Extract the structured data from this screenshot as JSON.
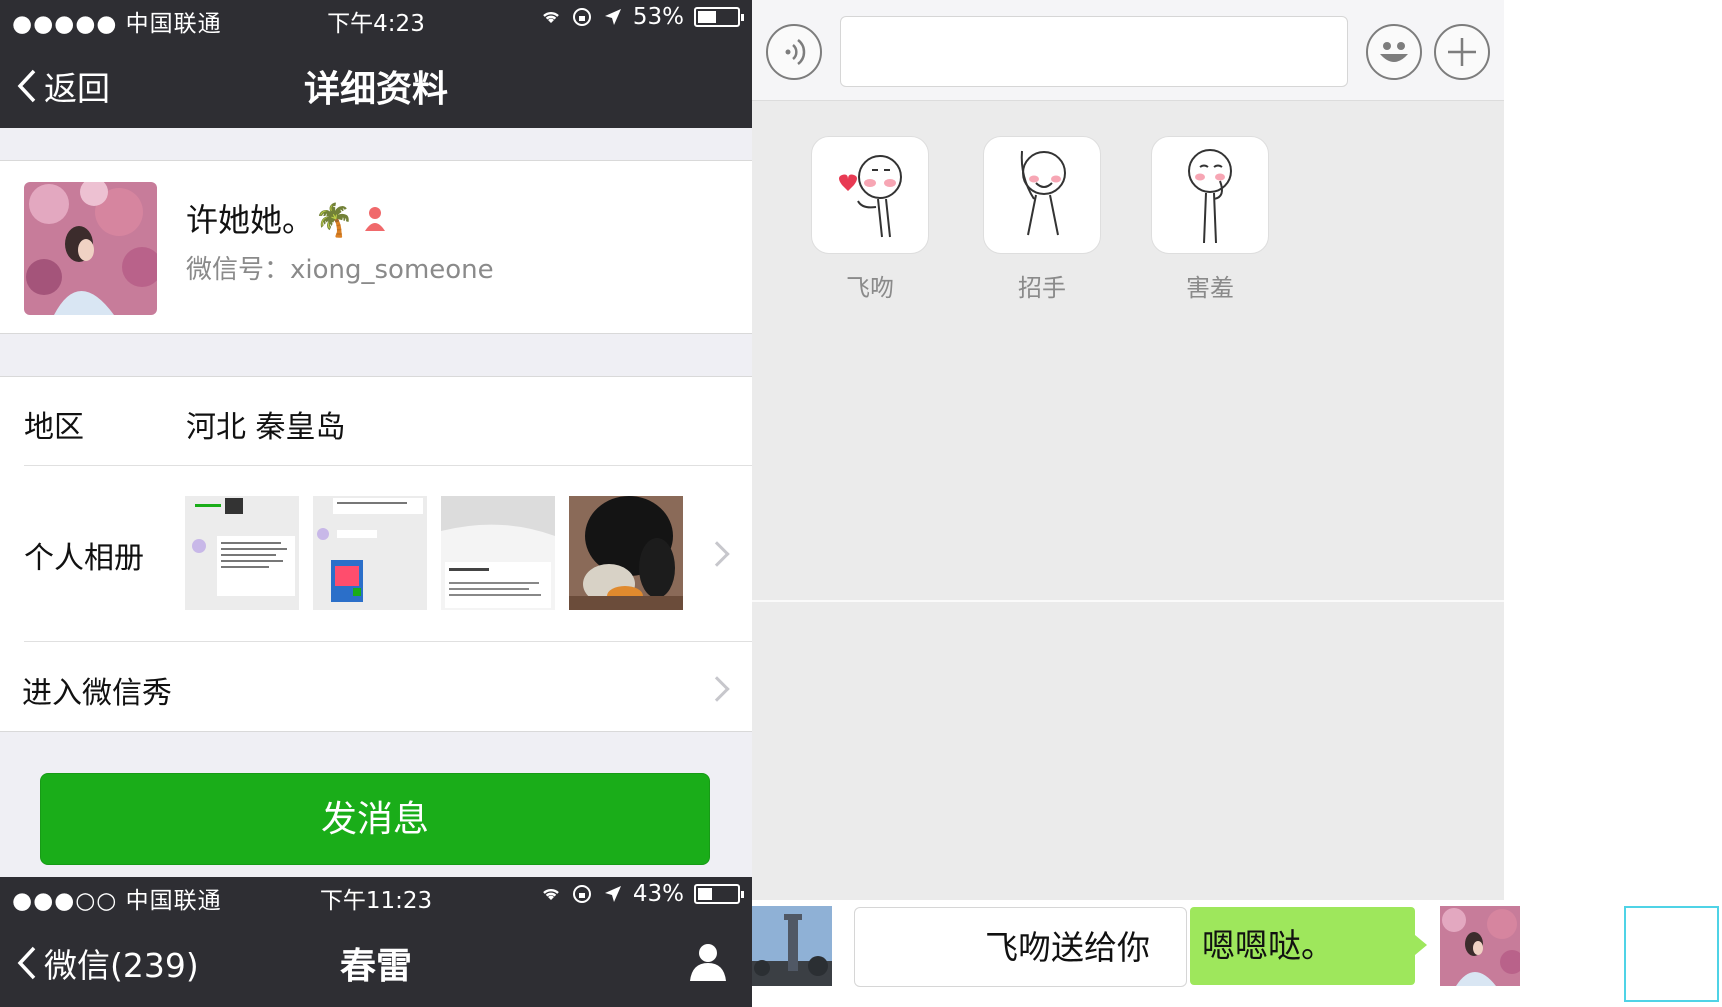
{
  "screen1": {
    "status": {
      "carrier": "●●●●● 中国联通",
      "time": "下午4:23",
      "battery": "53%",
      "battery_level": 0.53
    },
    "nav": {
      "back_label": "返回",
      "title": "详细资料"
    },
    "profile": {
      "name": "许她她。🌴",
      "wechat_id": "微信号：xiong_someone"
    },
    "region": {
      "label": "地区",
      "value": "河北 秦皇岛"
    },
    "album": {
      "label": "个人相册",
      "thumbs": [
        {
          "text": "网址：wxs…  好友的朋友圈 一次微信号…"
        },
        {
          "text": "台信号，不能具体单纯，不能告诉"
        },
        {
          "text": "投诉成功通知"
        },
        {
          "text": ""
        }
      ]
    },
    "wechat_show": {
      "label": "进入微信秀"
    },
    "send_button": "发消息"
  },
  "screen2": {
    "status": {
      "carrier": "●●●○○ 中国联通",
      "time": "下午11:23",
      "battery": "43%",
      "battery_level": 0.43
    },
    "nav": {
      "back_label": "微信(239)",
      "title": "春雷"
    }
  },
  "chat": {
    "stickers": [
      {
        "label": "飞吻"
      },
      {
        "label": "招手"
      },
      {
        "label": "害羞"
      }
    ],
    "bubble_received": "飞吻送给你",
    "bubble_sent": "嗯嗯哒。"
  },
  "colors": {
    "nav_bg": "#2e2e33",
    "send_green": "#1aad19",
    "bubble_green": "#9ee75c",
    "selection": "#4fd3e6"
  }
}
